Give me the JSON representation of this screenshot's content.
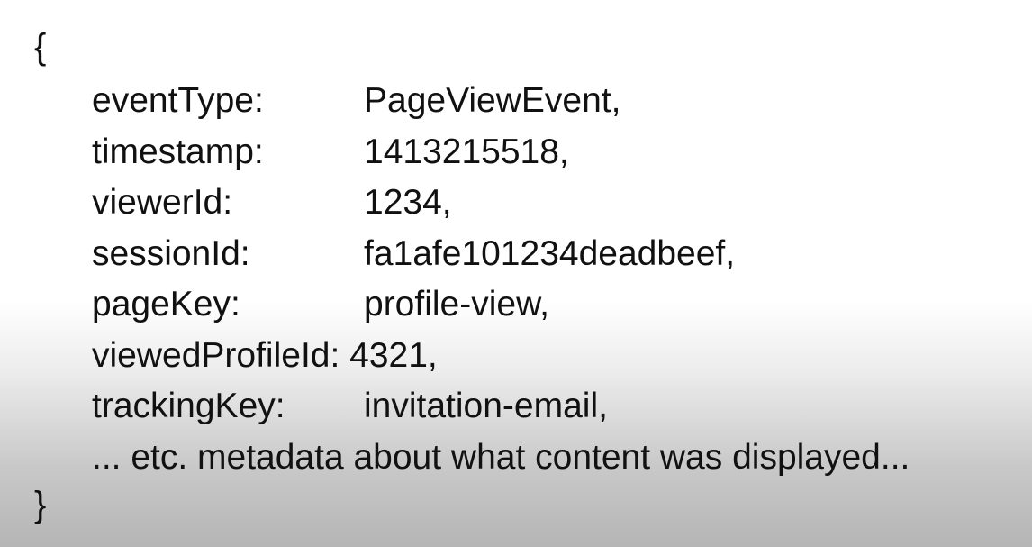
{
  "open_brace": "{",
  "close_brace": "}",
  "fields": [
    {
      "key": "eventType:",
      "value": "PageViewEvent,"
    },
    {
      "key": "timestamp:",
      "value": "1413215518,"
    },
    {
      "key": "viewerId:",
      "value": "1234,"
    },
    {
      "key": "sessionId:",
      "value": "fa1afe101234deadbeef,"
    },
    {
      "key": "pageKey:",
      "value": "profile-view,"
    },
    {
      "key": "viewedProfileId:",
      "value": "4321,"
    },
    {
      "key": "trackingKey:",
      "value": "invitation-email,"
    }
  ],
  "trailing_note": "... etc. metadata about what content was displayed..."
}
